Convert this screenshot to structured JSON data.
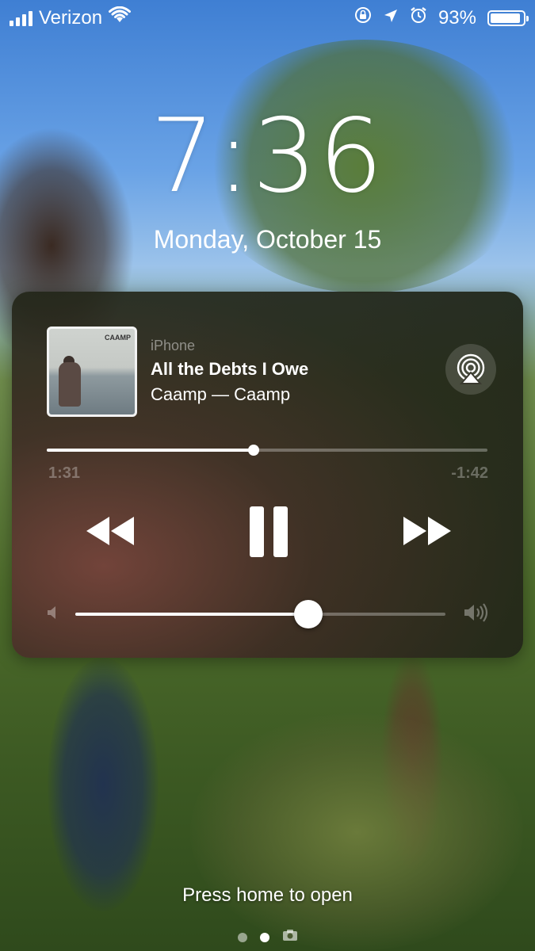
{
  "status_bar": {
    "carrier": "Verizon",
    "battery_percent": "93%",
    "battery_level": 0.93,
    "signal_bars": 4,
    "icons": [
      "wifi-icon",
      "rotation-lock-icon",
      "location-arrow-icon",
      "alarm-icon",
      "battery-icon"
    ]
  },
  "lock_screen": {
    "time": "7:36",
    "date": "Monday, October 15"
  },
  "now_playing": {
    "source": "iPhone",
    "title": "All the Debts I Owe",
    "artist_album": "Caamp — Caamp",
    "album_art_text": "CAAMP",
    "elapsed": "1:31",
    "remaining": "-1:42",
    "progress": 0.47,
    "volume": 0.63,
    "controls": [
      "rewind-icon",
      "pause-icon",
      "fast-forward-icon"
    ],
    "airplay_icon": "airplay-icon"
  },
  "footer": {
    "hint": "Press home to open",
    "page_dots": 3,
    "active_dot": 1
  },
  "colors": {
    "panel_bg": "#23261a",
    "text_dim": "rgba(255,255,255,0.45)"
  }
}
